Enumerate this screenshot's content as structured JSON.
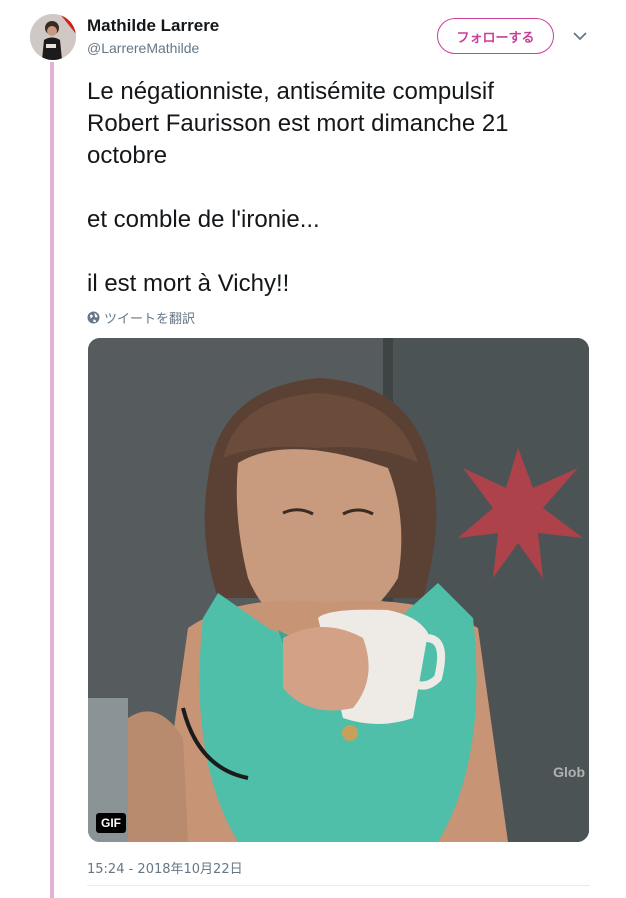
{
  "author": {
    "name": "Mathilde Larrere",
    "handle": "@LarrereMathilde"
  },
  "follow_label": "フォローする",
  "tweet": {
    "text": "Le négationniste, antisémite compulsif\nRobert Faurisson est mort dimanche 21\noctobre\n\net comble de l'ironie...\n\nil est mort à Vichy!!"
  },
  "translate_label": "ツイートを翻訳",
  "media": {
    "badge": "GIF",
    "watermark": "Glob"
  },
  "timestamp": "15:24 - 2018年10月22日",
  "colors": {
    "accent": "#c8409a",
    "thread_line": "#e3b3d6",
    "secondary_text": "#657786"
  },
  "icons": {
    "globe": "globe-icon",
    "caret": "chevron-down-icon"
  }
}
